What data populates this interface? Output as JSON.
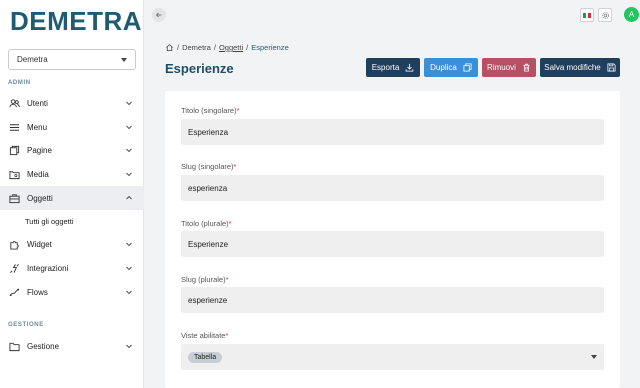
{
  "sidebar": {
    "logo": "DEMETRA",
    "project_select": "Demetra",
    "admin_label": "ADMIN",
    "items": [
      {
        "label": "Utenti",
        "icon": "users-icon"
      },
      {
        "label": "Menu",
        "icon": "menu-icon"
      },
      {
        "label": "Pagine",
        "icon": "pages-icon"
      },
      {
        "label": "Media",
        "icon": "media-icon"
      },
      {
        "label": "Oggetti",
        "icon": "briefcase-icon"
      },
      {
        "label": "Widget",
        "icon": "puzzle-icon"
      },
      {
        "label": "Integrazioni",
        "icon": "plug-icon"
      },
      {
        "label": "Flows",
        "icon": "flow-icon"
      }
    ],
    "sub_item": "Tutti gli oggetti",
    "gestione_label": "GESTIONE",
    "gestione_items": [
      {
        "label": "Gestione",
        "icon": "folder-icon"
      }
    ]
  },
  "topbar": {
    "avatar": "A"
  },
  "breadcrumb": {
    "items": [
      "Demetra",
      "Oggetti",
      "Esperienze"
    ]
  },
  "page": {
    "title": "Esperienze"
  },
  "actions": {
    "esporta": "Esporta",
    "duplica": "Duplica",
    "rimuovi": "Rimuovi",
    "salva": "Salva modifiche"
  },
  "form": {
    "fields": [
      {
        "label": "Titolo (singolare)",
        "value": "Esperienza"
      },
      {
        "label": "Slug (singolare)",
        "value": "esperienza"
      },
      {
        "label": "Titolo (plurale)",
        "value": "Esperienze"
      },
      {
        "label": "Slug (plurale)",
        "value": "esperienze"
      }
    ],
    "views": {
      "label": "Viste abilitate",
      "chip": "Tabella"
    },
    "required_mark": "*"
  },
  "colors": {
    "brand": "#1f5b72",
    "primary": "#1f3f5c",
    "info": "#3a8fd6",
    "danger": "#b65064",
    "success": "#22c55e"
  }
}
